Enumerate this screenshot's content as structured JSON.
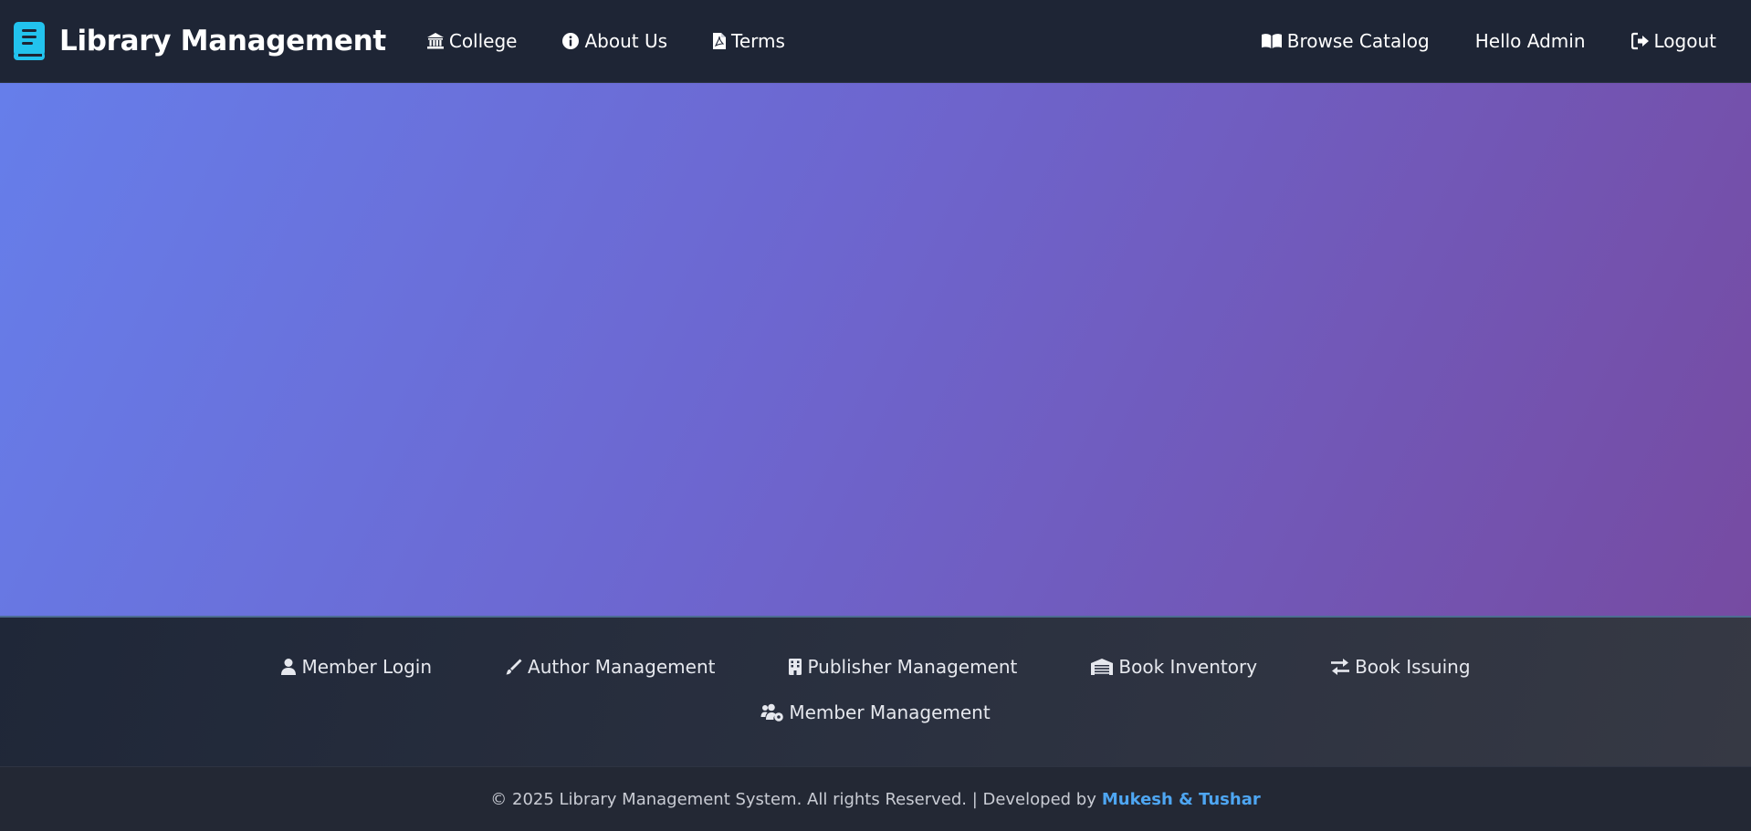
{
  "nav": {
    "brand": "Library Management",
    "left": [
      {
        "label": "College",
        "icon": "institution-icon"
      },
      {
        "label": "About Us",
        "icon": "info-circle-icon"
      },
      {
        "label": "Terms",
        "icon": "file-pdf-icon"
      }
    ],
    "right": [
      {
        "label": "Browse Catalog",
        "icon": "book-open-icon"
      },
      {
        "label": "Hello Admin"
      },
      {
        "label": "Logout",
        "icon": "sign-out-icon"
      }
    ]
  },
  "footer": {
    "links": [
      {
        "label": "Member Login",
        "icon": "user-icon"
      },
      {
        "label": "Author Management",
        "icon": "pen-icon"
      },
      {
        "label": "Publisher Management",
        "icon": "building-icon"
      },
      {
        "label": "Book Inventory",
        "icon": "warehouse-icon"
      },
      {
        "label": "Book Issuing",
        "icon": "exchange-icon"
      },
      {
        "label": "Member Management",
        "icon": "users-cog-icon"
      }
    ],
    "copyright": "© 2025 Library Management System. All rights Reserved. | Developed by",
    "developers": "Mukesh & Tushar"
  },
  "colors": {
    "navbar": "#1e2535",
    "brand_icon": "#22c3ee",
    "gradient_start": "#667eea",
    "gradient_end": "#764ba2",
    "developer_link": "#4ea6f2"
  }
}
